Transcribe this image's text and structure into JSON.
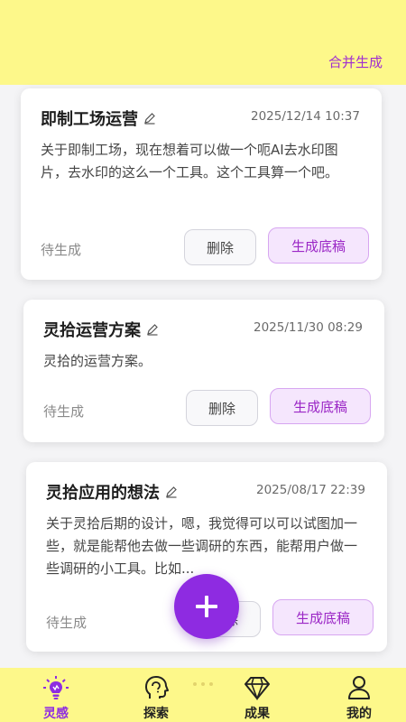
{
  "header": {
    "merge_label": "合并生成"
  },
  "cards": [
    {
      "title": "即制工场运营",
      "time": "2025/12/14 10:37",
      "body": "关于即制工场，现在想着可以做一个呃AI去水印图片，去水印的这么一个工具。这个工具算一个吧。",
      "status": "待生成",
      "delete_label": "删除",
      "draft_label": "生成底稿"
    },
    {
      "title": "灵拾运营方案",
      "time": "2025/11/30 08:29",
      "body": "灵拾的运营方案。",
      "status": "待生成",
      "delete_label": "删除",
      "draft_label": "生成底稿"
    },
    {
      "title": "灵拾应用的想法",
      "time": "2025/08/17 22:39",
      "body": "关于灵拾后期的设计，嗯，我觉得可以可以试图加一些，就是能帮他去做一些调研的东西，能帮用户做一些调研的小工具。比如...",
      "status": "待生成",
      "delete_label": "删除",
      "draft_label": "生成底稿"
    }
  ],
  "fab": {
    "icon": "plus-icon"
  },
  "nav": {
    "items": [
      {
        "label": "灵感",
        "icon": "lightbulb-icon",
        "active": true
      },
      {
        "label": "探索",
        "icon": "head-icon",
        "active": false
      },
      {
        "label": "成果",
        "icon": "diamond-icon",
        "active": false
      },
      {
        "label": "我的",
        "icon": "user-icon",
        "active": false
      }
    ]
  },
  "colors": {
    "header_bg": "#fdf88a",
    "accent": "#8e2be1",
    "draft_button_bg": "#f5e6fd"
  }
}
